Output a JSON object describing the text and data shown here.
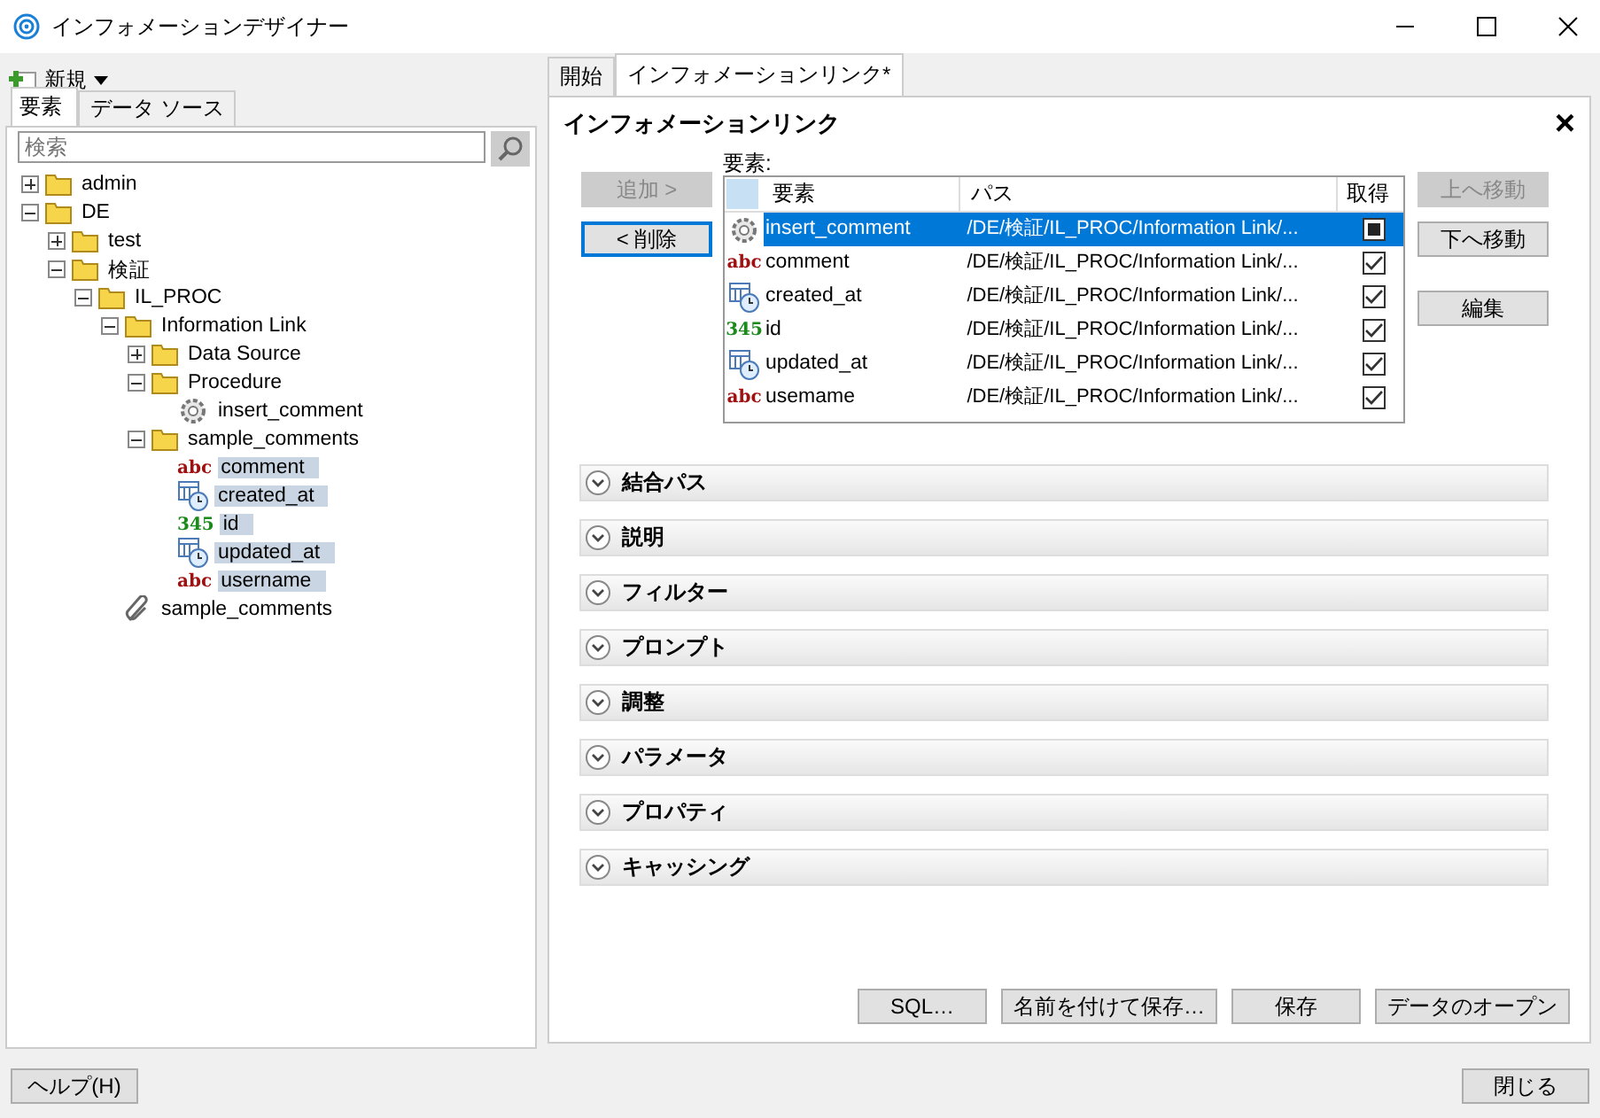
{
  "window": {
    "title": "インフォメーションデザイナー"
  },
  "left": {
    "new_button": "新規",
    "tabs": [
      {
        "label": "要素",
        "selected": true
      },
      {
        "label": "データ ソース",
        "selected": false
      }
    ],
    "search": {
      "placeholder": "検索"
    },
    "tree": [
      {
        "label": "admin",
        "kind": "folder",
        "expanded": false,
        "selected": false
      },
      {
        "label": "DE",
        "kind": "folder",
        "expanded": true,
        "selected": false,
        "children": [
          {
            "label": "test",
            "kind": "folder",
            "expanded": false,
            "selected": false
          },
          {
            "label": "検証",
            "kind": "folder",
            "expanded": true,
            "selected": false,
            "children": [
              {
                "label": "IL_PROC",
                "kind": "folder",
                "expanded": true,
                "selected": false,
                "children": [
                  {
                    "label": "Information Link",
                    "kind": "folder",
                    "expanded": true,
                    "selected": false,
                    "children": [
                      {
                        "label": "Data Source",
                        "kind": "folder",
                        "expanded": false,
                        "selected": false
                      },
                      {
                        "label": "Procedure",
                        "kind": "folder",
                        "expanded": true,
                        "selected": false,
                        "children": [
                          {
                            "label": "insert_comment",
                            "kind": "procedure",
                            "selected": false
                          }
                        ]
                      },
                      {
                        "label": "sample_comments",
                        "kind": "folder",
                        "expanded": true,
                        "selected": false,
                        "children": [
                          {
                            "label": "comment",
                            "kind": "string",
                            "badge": "abc",
                            "selected": true
                          },
                          {
                            "label": "created_at",
                            "kind": "datetime",
                            "selected": true
                          },
                          {
                            "label": "id",
                            "kind": "integer",
                            "badge": "345",
                            "selected": true
                          },
                          {
                            "label": "updated_at",
                            "kind": "datetime",
                            "selected": true
                          },
                          {
                            "label": "username",
                            "kind": "string",
                            "badge": "abc",
                            "selected": true
                          }
                        ]
                      }
                    ]
                  },
                  {
                    "label": "sample_comments",
                    "kind": "join",
                    "selected": false
                  }
                ]
              }
            ]
          }
        ]
      }
    ]
  },
  "right": {
    "tabs": [
      {
        "label": "開始",
        "selected": false
      },
      {
        "label": "インフォメーションリンク*",
        "selected": true
      }
    ],
    "title": "インフォメーションリンク",
    "close": "×",
    "elements_label": "要素:",
    "add_button": {
      "label": "追加 >",
      "disabled": true
    },
    "remove_button": {
      "label": "< 削除",
      "disabled": false
    },
    "columns": [
      "要素",
      "パス",
      "取得"
    ],
    "rows": [
      {
        "kind": "procedure",
        "name": "insert_comment",
        "path": "/DE/検証/IL_PROC/Information Link/...",
        "checked": true,
        "selected": true
      },
      {
        "kind": "string",
        "badge": "abc",
        "name": "comment",
        "path": "/DE/検証/IL_PROC/Information Link/...",
        "checked": true,
        "selected": false
      },
      {
        "kind": "datetime",
        "name": "created_at",
        "path": "/DE/検証/IL_PROC/Information Link/...",
        "checked": true,
        "selected": false
      },
      {
        "kind": "integer",
        "badge": "345",
        "name": "id",
        "path": "/DE/検証/IL_PROC/Information Link/...",
        "checked": true,
        "selected": false
      },
      {
        "kind": "datetime",
        "name": "updated_at",
        "path": "/DE/検証/IL_PROC/Information Link/...",
        "checked": true,
        "selected": false
      },
      {
        "kind": "string",
        "badge": "abc",
        "name": "usemame",
        "path": "/DE/検証/IL_PROC/Information Link/...",
        "checked": true,
        "selected": false
      }
    ],
    "side_buttons": [
      {
        "label": "上へ移動",
        "disabled": true
      },
      {
        "label": "下へ移動",
        "disabled": false
      },
      {
        "label": "編集",
        "disabled": false
      }
    ],
    "sections": [
      {
        "label": "結合パス",
        "expanded": false
      },
      {
        "label": "説明",
        "expanded": false
      },
      {
        "label": "フィルター",
        "expanded": false
      },
      {
        "label": "プロンプト",
        "expanded": false
      },
      {
        "label": "調整",
        "expanded": false
      },
      {
        "label": "パラメータ",
        "expanded": false
      },
      {
        "label": "プロパティ",
        "expanded": false
      },
      {
        "label": "キャッシング",
        "expanded": false
      }
    ],
    "bottom_buttons": [
      "SQL…",
      "名前を付けて保存…",
      "保存",
      "データのオープン"
    ]
  },
  "footer": {
    "help_button": "ヘルプ(H)",
    "close_button": "閉じる"
  }
}
